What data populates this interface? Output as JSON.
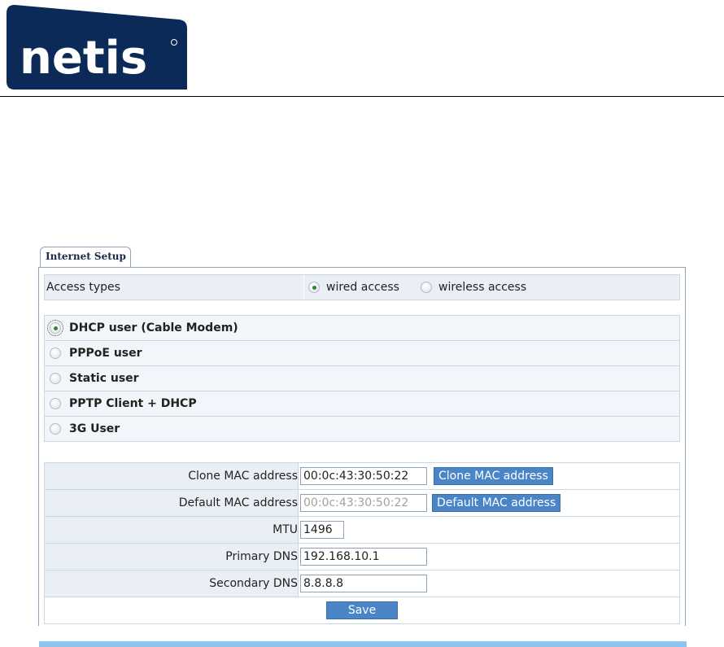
{
  "brand": {
    "logo_text": "netis",
    "logo_bg": "#0c2a57"
  },
  "panel": {
    "tab_label": "Internet Setup"
  },
  "access_types": {
    "label": "Access types",
    "options": [
      {
        "label": "wired access",
        "selected": true
      },
      {
        "label": "wireless access",
        "selected": false
      }
    ]
  },
  "connection_types": [
    {
      "label": "DHCP user (Cable Modem)",
      "selected": true
    },
    {
      "label": "PPPoE user",
      "selected": false
    },
    {
      "label": "Static user",
      "selected": false
    },
    {
      "label": "PPTP Client + DHCP",
      "selected": false
    },
    {
      "label": "3G User",
      "selected": false
    }
  ],
  "form": {
    "clone_mac": {
      "label": "Clone MAC address",
      "value": "00:0c:43:30:50:22",
      "button": "Clone MAC address"
    },
    "default_mac": {
      "label": "Default MAC address",
      "value": "00:0c:43:30:50:22",
      "button": "Default MAC address"
    },
    "mtu": {
      "label": "MTU",
      "value": "1496"
    },
    "primary_dns": {
      "label": "Primary DNS",
      "value": "192.168.10.1"
    },
    "secondary_dns": {
      "label": "Secondary DNS",
      "value": "8.8.8.8"
    },
    "save_label": "Save"
  },
  "colors": {
    "accent_button": "#4a85c7",
    "row_bg": "#e9eff5",
    "selected_radio": "#2d8a2d"
  }
}
